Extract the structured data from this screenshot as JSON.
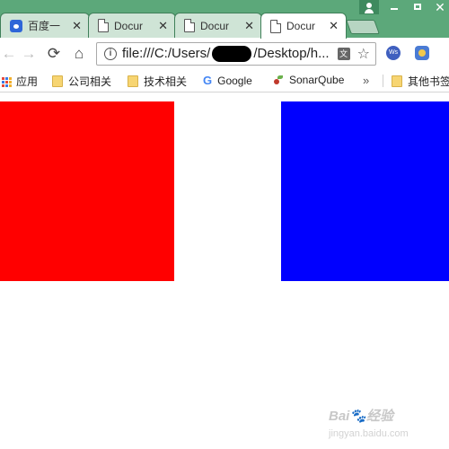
{
  "tabs": [
    {
      "title": "百度一",
      "favicon": "baidu-paw-icon",
      "active": false
    },
    {
      "title": "Docur",
      "favicon": "document-icon",
      "active": false
    },
    {
      "title": "Docur",
      "favicon": "document-icon",
      "active": false
    },
    {
      "title": "Docur",
      "favicon": "document-icon",
      "active": true
    }
  ],
  "tab_close_glyph": "✕",
  "window": {
    "close_glyph": "✕"
  },
  "toolbar": {
    "back_glyph": "←",
    "forward_glyph": "→",
    "reload_glyph": "⟳",
    "home_glyph": "⌂"
  },
  "address": {
    "info_glyph": "i",
    "url_prefix": "file:///C:/Users/",
    "url_suffix": "/Desktop/h...",
    "star_glyph": "☆"
  },
  "bookmarks": {
    "apps": "应用",
    "items": [
      "公司相关",
      "技术相关",
      "Google",
      "SonarQube"
    ],
    "overflow_glyph": "»",
    "other": "其他书签"
  },
  "content": {
    "boxes": [
      {
        "name": "red-box",
        "color": "#ff0000"
      },
      {
        "name": "blue-box",
        "color": "#0000ff"
      }
    ]
  },
  "watermark": {
    "text": "Bai",
    "text2": "经验",
    "sub": "jingyan.baidu.com"
  },
  "colors": {
    "tabstrip": "#5ca87a",
    "active_tab": "#ffffff"
  }
}
